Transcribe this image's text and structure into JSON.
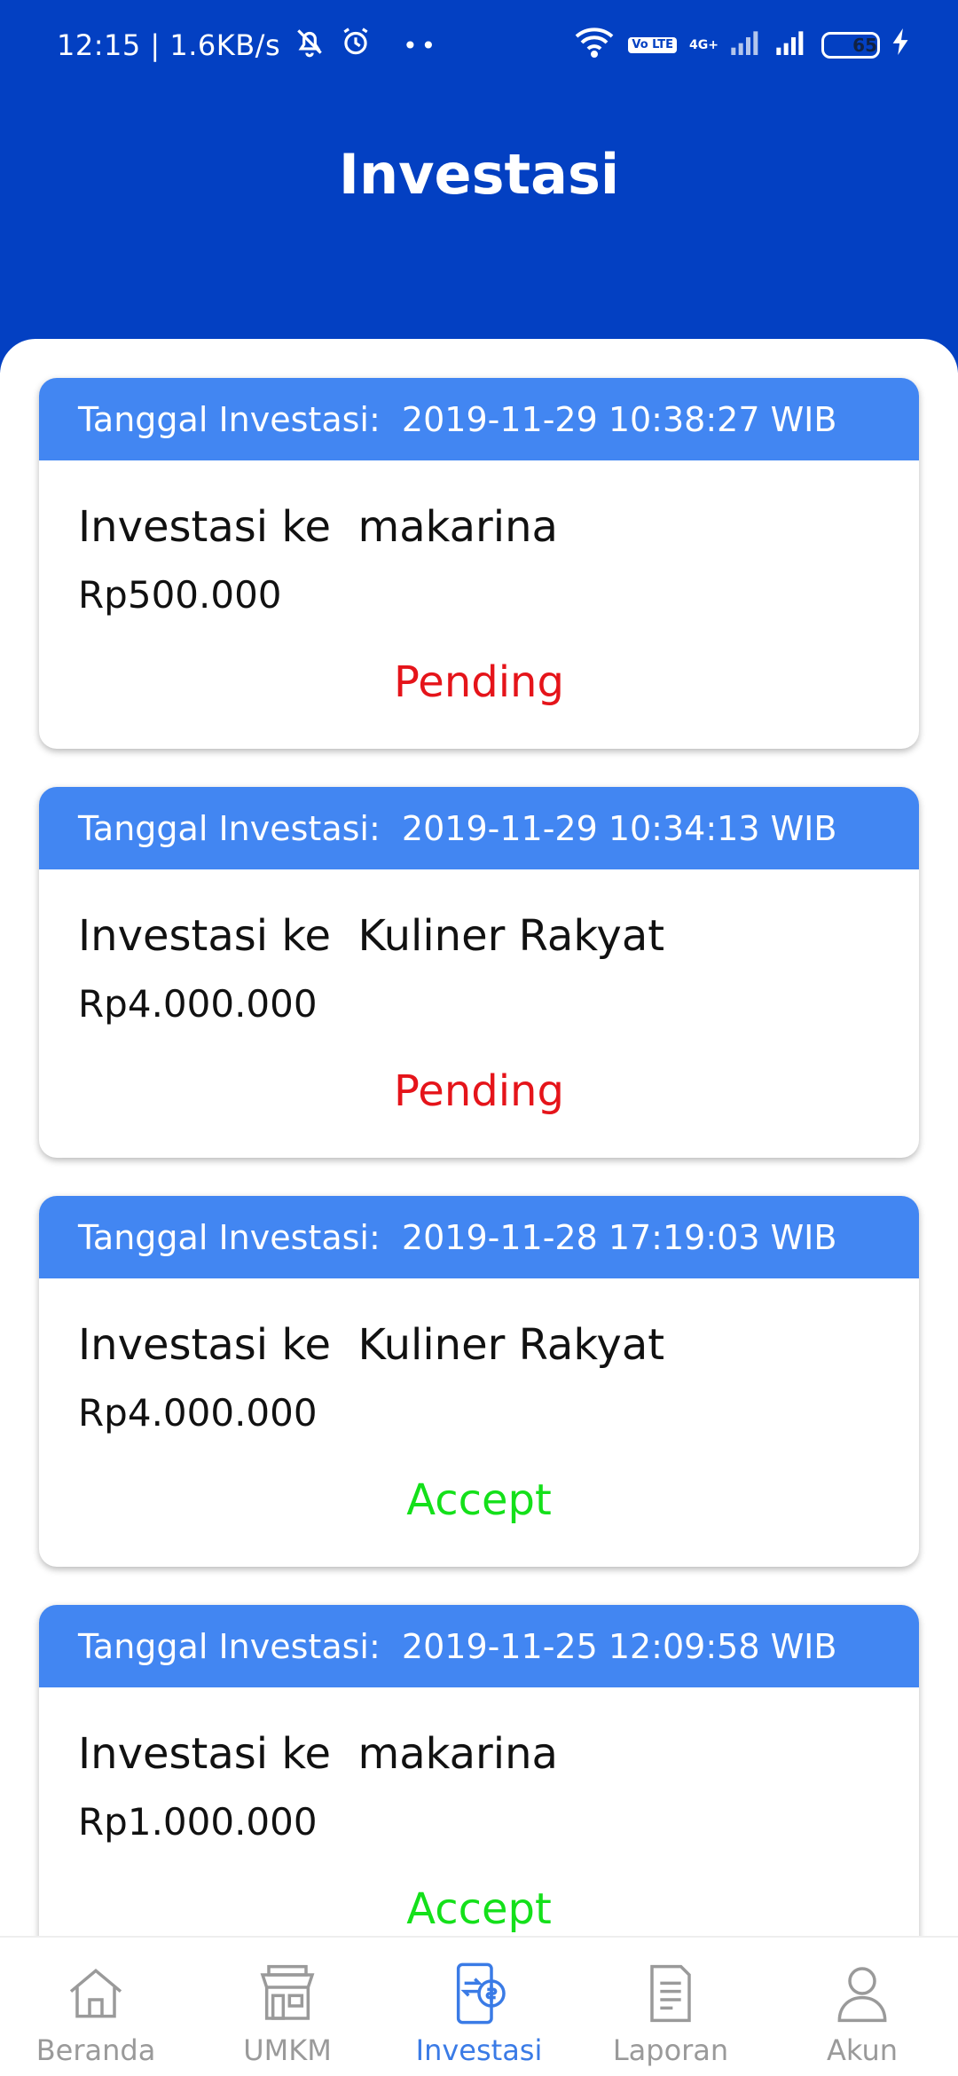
{
  "status_bar": {
    "time_speed": "12:15 | 1.6KB/s",
    "dots": "••",
    "volte": "Vo LTE",
    "network": "4G+",
    "battery": "65"
  },
  "header": {
    "title": "Investasi"
  },
  "investments": [
    {
      "date_label": "Tanggal Investasi:  2019-11-29 10:38:27 WIB",
      "title": "Investasi ke  makarina",
      "amount": "Rp500.000",
      "status": "Pending"
    },
    {
      "date_label": "Tanggal Investasi:  2019-11-29 10:34:13 WIB",
      "title": "Investasi ke  Kuliner Rakyat",
      "amount": "Rp4.000.000",
      "status": "Pending"
    },
    {
      "date_label": "Tanggal Investasi:  2019-11-28 17:19:03 WIB",
      "title": "Investasi ke  Kuliner Rakyat",
      "amount": "Rp4.000.000",
      "status": "Accept"
    },
    {
      "date_label": "Tanggal Investasi:  2019-11-25 12:09:58 WIB",
      "title": "Investasi ke  makarina",
      "amount": "Rp1.000.000",
      "status": "Accept"
    }
  ],
  "bottom_nav": {
    "items": [
      {
        "label": "Beranda",
        "icon": "home-icon"
      },
      {
        "label": "UMKM",
        "icon": "store-icon"
      },
      {
        "label": "Investasi",
        "icon": "investment-icon",
        "active": true
      },
      {
        "label": "Laporan",
        "icon": "report-icon"
      },
      {
        "label": "Akun",
        "icon": "user-icon"
      }
    ]
  },
  "colors": {
    "header_bg": "#0340c2",
    "card_header_bg": "#4286f2",
    "pending": "#e5141a",
    "accept": "#14e01a",
    "nav_active": "#3a7be6",
    "nav_inactive": "#9a9a9a"
  }
}
